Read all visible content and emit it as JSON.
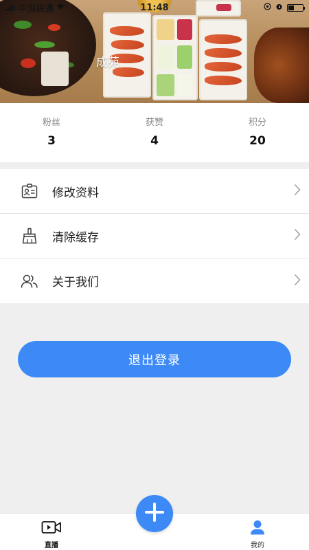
{
  "status_bar": {
    "carrier": "中国联通",
    "time": "11:48",
    "battery_level": 0.4
  },
  "profile": {
    "username": "成苑"
  },
  "stats": [
    {
      "label": "粉丝",
      "value": "3"
    },
    {
      "label": "获赞",
      "value": "4"
    },
    {
      "label": "积分",
      "value": "20"
    }
  ],
  "menu": [
    {
      "label": "修改资料",
      "icon": "id-card-icon"
    },
    {
      "label": "清除缓存",
      "icon": "broom-icon"
    },
    {
      "label": "关于我们",
      "icon": "users-icon"
    }
  ],
  "logout": {
    "label": "退出登录"
  },
  "tabbar": {
    "live_label": "直播",
    "mine_label": "我的",
    "add_icon": "plus-icon"
  },
  "colors": {
    "accent": "#3d8af7",
    "page_background": "#efefef"
  }
}
